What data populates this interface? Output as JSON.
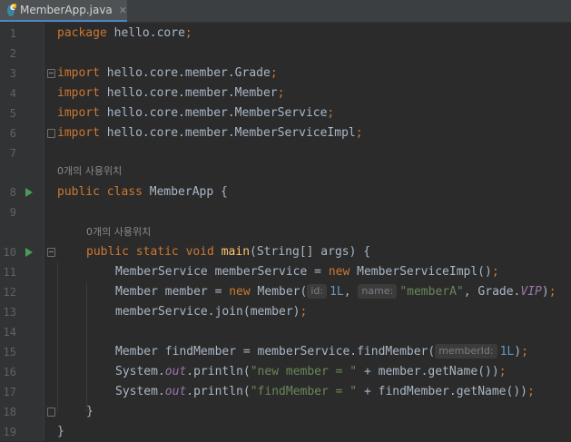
{
  "tab": {
    "filename": "MemberApp.java",
    "close_glyph": "✕",
    "icon": "java-class-icon"
  },
  "usage_hint": "0개의 사용위치",
  "lines": {
    "l1": {
      "num": "1",
      "kw": "package",
      "rest": " hello.core",
      "semi": ";"
    },
    "l2": {
      "num": "2"
    },
    "l3": {
      "num": "3",
      "kw": "import",
      "rest": " hello.core.member.Grade",
      "semi": ";"
    },
    "l4": {
      "num": "4",
      "kw": "import",
      "rest": " hello.core.member.Member",
      "semi": ";"
    },
    "l5": {
      "num": "5",
      "kw": "import",
      "rest": " hello.core.member.MemberService",
      "semi": ";"
    },
    "l6": {
      "num": "6",
      "kw": "import",
      "rest": " hello.core.member.MemberServiceImpl",
      "semi": ";"
    },
    "l7": {
      "num": "7"
    },
    "l8": {
      "num": "8",
      "kw": "public class",
      "rest": " MemberApp {"
    },
    "l9": {
      "num": "9"
    },
    "l10": {
      "num": "10",
      "kw": "public static void",
      "fn": "main",
      "rest": "(String[] args) {"
    },
    "l11": {
      "num": "11",
      "a": "MemberService memberService = ",
      "kw": "new",
      "b": " MemberServiceImpl()",
      "semi": ";"
    },
    "l12": {
      "num": "12",
      "a": "Member member = ",
      "kw": "new",
      "b": " Member(",
      "hint1": "id:",
      "n1": "1L",
      "c": ", ",
      "hint2": "name:",
      "s1": "\"memberA\"",
      "d": ", Grade.",
      "f1": "VIP",
      "e": ")",
      "semi": ";"
    },
    "l13": {
      "num": "13",
      "a": "memberService.join(member)",
      "semi": ";"
    },
    "l14": {
      "num": "14"
    },
    "l15": {
      "num": "15",
      "a": "Member findMember = memberService.findMember(",
      "hint1": "memberId:",
      "n1": "1L",
      "b": ")",
      "semi": ";"
    },
    "l16": {
      "num": "16",
      "a": "System.",
      "f1": "out",
      "b": ".println(",
      "s1": "\"new member = \"",
      "c": " + member.getName())",
      "semi": ";"
    },
    "l17": {
      "num": "17",
      "a": "System.",
      "f1": "out",
      "b": ".println(",
      "s1": "\"findMember = \"",
      "c": " + findMember.getName())",
      "semi": ";"
    },
    "l18": {
      "num": "18",
      "a": "}"
    },
    "l19": {
      "num": "19",
      "a": "}"
    }
  },
  "colors": {
    "keyword": "#cc7832",
    "string": "#6a8759",
    "number": "#6897bb",
    "method_decl": "#ffc66d",
    "static_field": "#9876aa",
    "default_text": "#a9b7c6",
    "background": "#2b2b2b",
    "run_icon": "#499c54"
  }
}
